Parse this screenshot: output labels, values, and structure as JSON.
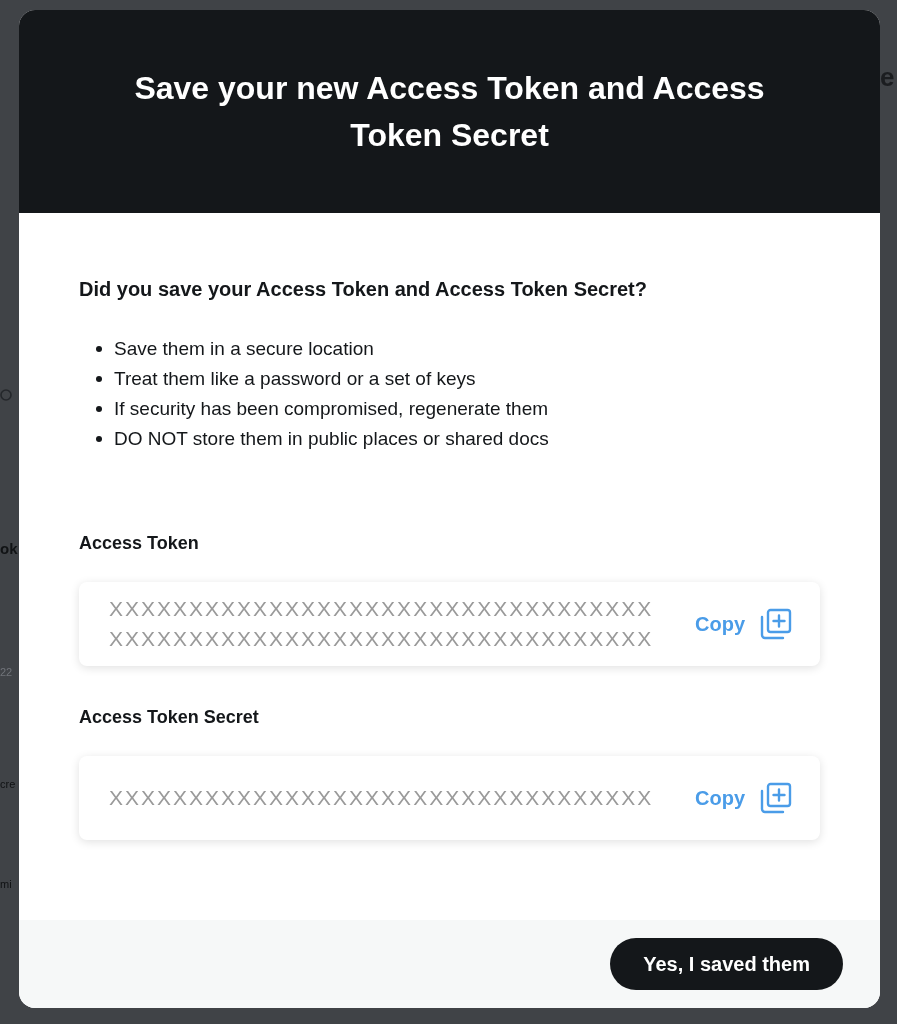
{
  "backdrop": {
    "left_fragments": [
      "ok",
      "22",
      "cre",
      "mi"
    ],
    "right_fragments": [
      "e"
    ]
  },
  "dialog": {
    "title": "Save your new Access Token and Access Token Secret",
    "question": "Did you save your Access Token and Access Token Secret?",
    "tips": [
      "Save them in a secure location",
      "Treat them like a password or a set of keys",
      "If security has been compromised, regenerate them",
      "DO NOT store them in public places or shared docs"
    ],
    "tokens": [
      {
        "label": "Access Token",
        "value": "XXXXXXXXXXXXXXXXXXXXXXXXXXXXXXXXXXXXXXXXXXXXXXXXXXXXXXXXXXXXXXXXXXXX",
        "copy_label": "Copy"
      },
      {
        "label": "Access Token Secret",
        "value": "XXXXXXXXXXXXXXXXXXXXXXXXXXXXXXXXXX",
        "copy_label": "Copy"
      }
    ],
    "confirm_button": "Yes, I saved them"
  }
}
